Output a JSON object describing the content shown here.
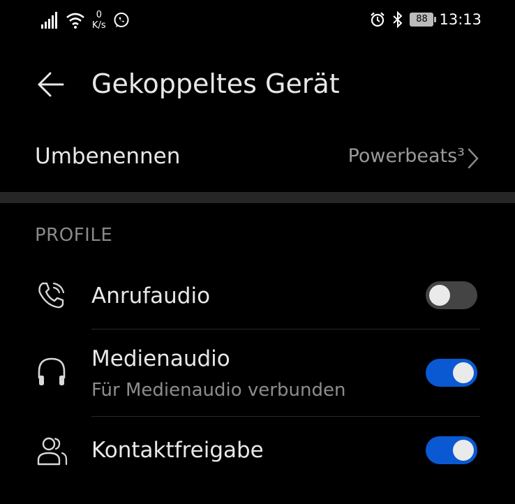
{
  "status_bar": {
    "net_speed_value": "0",
    "net_speed_unit": "K/s",
    "battery": "88",
    "time": "13:13",
    "icons": [
      "signal-icon",
      "wifi-icon",
      "whatsapp-icon",
      "alarm-icon",
      "bluetooth-icon",
      "battery-icon"
    ]
  },
  "header": {
    "title": "Gekoppeltes Gerät",
    "back_icon": "arrow-left-icon"
  },
  "rename": {
    "label": "Umbenennen",
    "value": "Powerbeats³"
  },
  "profiles": {
    "section_title": "PROFILE",
    "items": [
      {
        "icon": "phone-icon",
        "label": "Anrufaudio",
        "subtitle": "",
        "enabled": false
      },
      {
        "icon": "headphones-icon",
        "label": "Medienaudio",
        "subtitle": "Für Medienaudio verbunden",
        "enabled": true
      },
      {
        "icon": "contacts-icon",
        "label": "Kontaktfreigabe",
        "subtitle": "",
        "enabled": true
      }
    ]
  },
  "colors": {
    "background": "#000000",
    "toggle_on": "#0a59d3",
    "toggle_off": "#444444",
    "divider": "#262626"
  }
}
